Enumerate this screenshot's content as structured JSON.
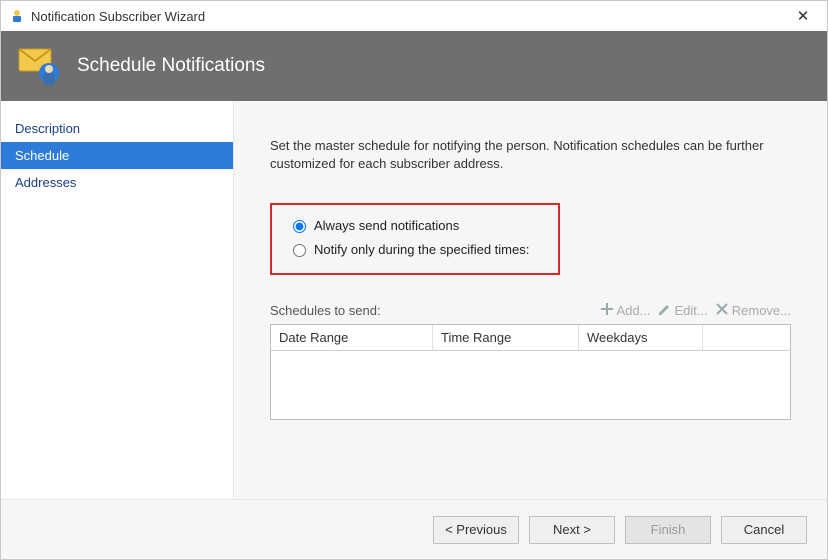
{
  "window": {
    "title": "Notification Subscriber Wizard"
  },
  "banner": {
    "title": "Schedule Notifications"
  },
  "sidebar": {
    "items": [
      {
        "label": "Description"
      },
      {
        "label": "Schedule"
      },
      {
        "label": "Addresses"
      }
    ],
    "selected_index": 1
  },
  "content": {
    "intro": "Set the master schedule for notifying the person. Notification schedules can be further customized for each subscriber address.",
    "radios": {
      "always": "Always send notifications",
      "specified": "Notify only during the specified times:",
      "selected": "always"
    },
    "schedules_label": "Schedules to send:",
    "toolbar": {
      "add": "Add...",
      "edit": "Edit...",
      "remove": "Remove..."
    },
    "table": {
      "columns": [
        "Date Range",
        "Time Range",
        "Weekdays",
        ""
      ],
      "rows": []
    }
  },
  "footer": {
    "previous": "< Previous",
    "next": "Next >",
    "finish": "Finish",
    "cancel": "Cancel"
  }
}
